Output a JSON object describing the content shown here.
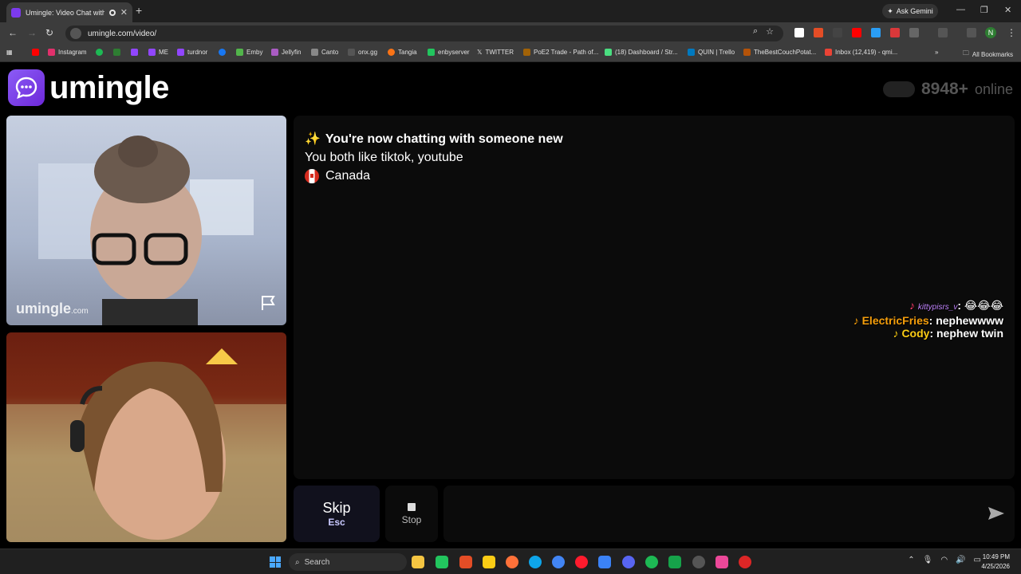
{
  "browser": {
    "tab_title": "Umingle: Video Chat with S",
    "ask_gemini": "Ask Gemini",
    "url": "umingle.com/video/",
    "bookmarks": [
      "Instagram",
      "ME",
      "turdnor",
      "Emby",
      "Jellyfin",
      "Canto",
      "onx.gg",
      "Tangia",
      "enbyserver",
      "TWITTER",
      "PoE2 Trade - Path of...",
      "(18) Dashboard / Str...",
      "QUIN | Trello",
      "TheBestCouchPotat...",
      "Inbox (12,419) - qmi..."
    ],
    "all_bookmarks": "All Bookmarks",
    "profile_initial": "N"
  },
  "site": {
    "logo_text": "umingle",
    "online_count": "8948+",
    "online_label": "online"
  },
  "video": {
    "watermark": "umingle",
    "watermark_suffix": ".com"
  },
  "chat": {
    "headline": "You're now chatting with someone new",
    "interests": "You both like tiktok, youtube",
    "country": "Canada"
  },
  "overlay": {
    "line1_name": "kittypisrs_v",
    "line1_msg": ": 😂😂😂",
    "line2_name": "ElectricFries",
    "line2_msg": ": nephewwww",
    "line3_name": "Cody",
    "line3_msg": ": nephew twin"
  },
  "controls": {
    "skip_label": "Skip",
    "skip_key": "Esc",
    "stop_label": "Stop",
    "message_placeholder": ""
  },
  "taskbar": {
    "search_label": "Search",
    "time": "10:49 PM",
    "date": "4/25/2026"
  },
  "colors": {
    "brand": "#7c3aed",
    "accent_orange": "#f59e0b",
    "accent_yellow": "#facc15"
  }
}
